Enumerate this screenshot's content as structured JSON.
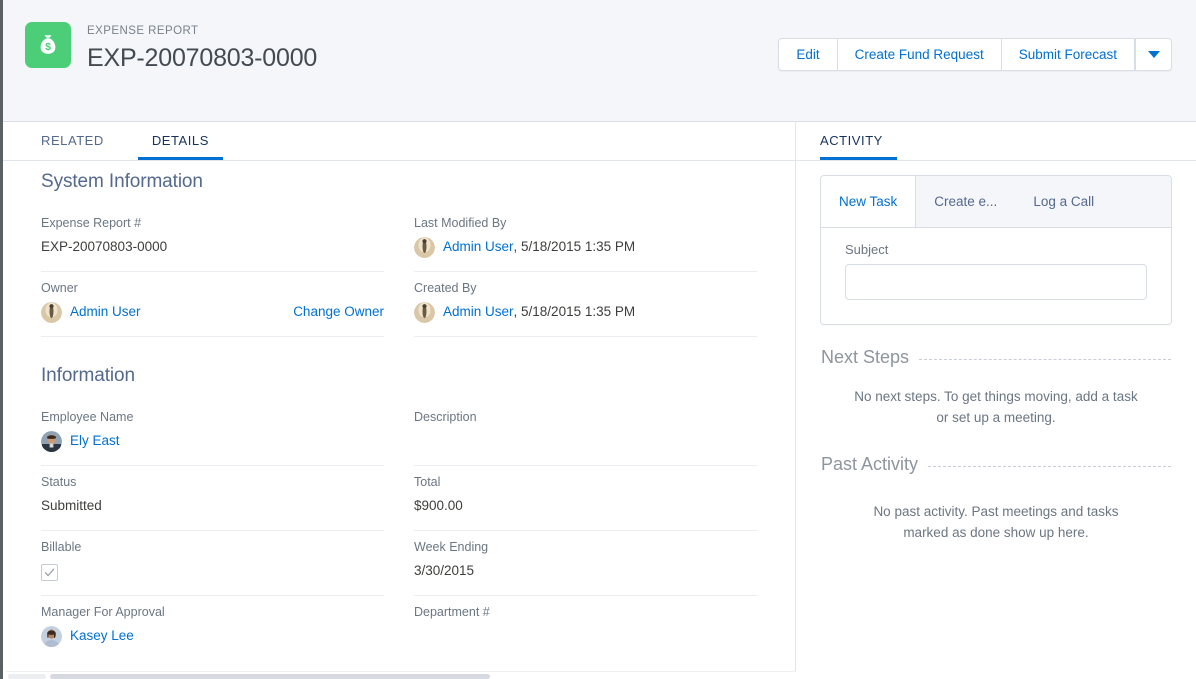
{
  "header": {
    "icon_name": "money-bag-icon",
    "icon_color": "#4bce77",
    "eyebrow": "EXPENSE REPORT",
    "title": "EXP-20070803-0000",
    "actions": [
      {
        "label": "Edit"
      },
      {
        "label": "Create Fund Request"
      },
      {
        "label": "Submit Forecast"
      }
    ],
    "more_actions_icon": "chevron-down-icon"
  },
  "main": {
    "tabs": [
      {
        "label": "RELATED",
        "active": false
      },
      {
        "label": "DETAILS",
        "active": true
      }
    ],
    "sections": [
      {
        "title": "System Information",
        "left_fields": [
          {
            "label": "Expense Report #",
            "value": "EXP-20070803-0000",
            "type": "text"
          },
          {
            "label": "Owner",
            "value": "Admin User",
            "type": "user",
            "avatar": "admin-user-avatar",
            "action": "Change Owner"
          }
        ],
        "right_fields": [
          {
            "label": "Last Modified By",
            "value": "Admin User",
            "meta": ", 5/18/2015 1:35 PM",
            "type": "user",
            "avatar": "admin-user-avatar"
          },
          {
            "label": "Created By",
            "value": "Admin User",
            "meta": ", 5/18/2015 1:35 PM",
            "type": "user",
            "avatar": "admin-user-avatar"
          }
        ]
      },
      {
        "title": "Information",
        "left_fields": [
          {
            "label": "Employee Name",
            "value": "Ely East",
            "type": "user",
            "avatar": "ely-east-avatar"
          },
          {
            "label": "Status",
            "value": "Submitted",
            "type": "text"
          },
          {
            "label": "Billable",
            "value": "",
            "type": "checkbox",
            "checked": true
          },
          {
            "label": "Manager For Approval",
            "value": "Kasey Lee",
            "type": "user",
            "avatar": "kasey-lee-avatar"
          }
        ],
        "right_fields": [
          {
            "label": "Description",
            "value": "",
            "type": "text"
          },
          {
            "label": "Total",
            "value": "$900.00",
            "type": "text"
          },
          {
            "label": "Week Ending",
            "value": "3/30/2015",
            "type": "text"
          },
          {
            "label": "Department #",
            "value": "",
            "type": "text"
          }
        ]
      }
    ]
  },
  "side": {
    "tabs": [
      {
        "label": "ACTIVITY",
        "active": true
      }
    ],
    "composer": {
      "tabs": [
        {
          "label": "New Task",
          "active": true
        },
        {
          "label": "Create e...",
          "active": false
        },
        {
          "label": "Log a Call",
          "active": false
        }
      ],
      "subject_label": "Subject",
      "subject_value": "",
      "subject_placeholder": ""
    },
    "next_steps": {
      "title": "Next Steps",
      "empty_message": "No next steps. To get things moving, add a task or set up a meeting."
    },
    "past_activity": {
      "title": "Past Activity",
      "empty_message": "No past activity. Past meetings and tasks marked as done show up here."
    }
  },
  "colors": {
    "link": "#0070d2",
    "accent": "#0070d2",
    "header_bg": "#f4f6f9",
    "icon_green": "#4bce77"
  }
}
